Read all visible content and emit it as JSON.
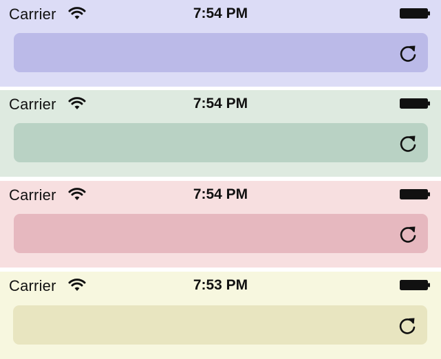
{
  "panels": [
    {
      "carrier": "Carrier",
      "time": "7:54 PM",
      "bg": "#dcdcf6",
      "bar": "#bbbae8"
    },
    {
      "carrier": "Carrier",
      "time": "7:54 PM",
      "bg": "#deeae0",
      "bar": "#b9d2c4"
    },
    {
      "carrier": "Carrier",
      "time": "7:54 PM",
      "bg": "#f7dfe0",
      "bar": "#e6b8bf"
    },
    {
      "carrier": "Carrier",
      "time": "7:53 PM",
      "bg": "#f7f7df",
      "bar": "#e8e5c0"
    }
  ],
  "icons": {
    "wifi": "wifi-icon",
    "battery": "battery-icon",
    "reload": "reload-icon"
  }
}
